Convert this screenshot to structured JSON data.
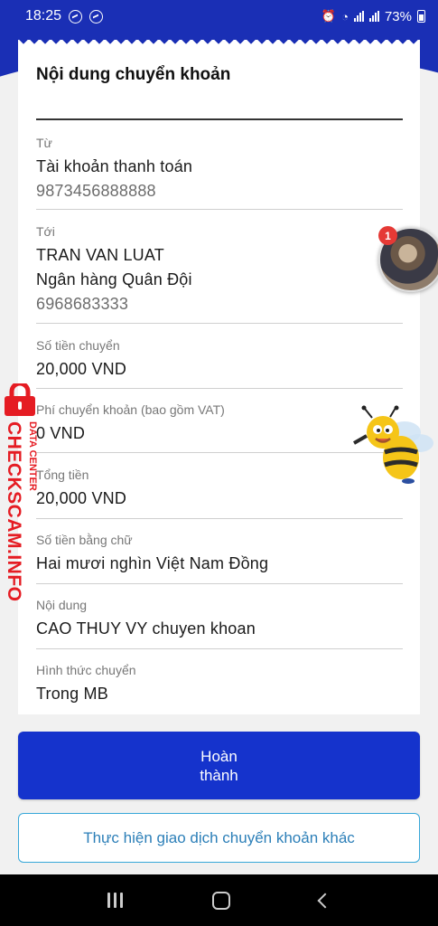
{
  "status_bar": {
    "time": "18:25",
    "battery": "73%"
  },
  "card": {
    "title": "Nội dung chuyển khoản"
  },
  "fields": {
    "from": {
      "label": "Từ",
      "account_type": "Tài khoản thanh toán",
      "account_number": "9873456888888"
    },
    "to": {
      "label": "Tới",
      "name": "TRAN VAN LUAT",
      "bank": "Ngân hàng Quân Đội",
      "account_number": "6968683333"
    },
    "amount": {
      "label": "Số tiền chuyển",
      "value": "20,000 VND"
    },
    "fee": {
      "label": "Phí chuyển khoản (bao gồm VAT)",
      "value": "0 VND"
    },
    "total": {
      "label": "Tổng tiền",
      "value": "20,000 VND"
    },
    "amount_words": {
      "label": "Số tiền bằng chữ",
      "value": "Hai mươi nghìn Việt Nam Đồng"
    },
    "content": {
      "label": "Nội dung",
      "value": "CAO THUY VY chuyen khoan"
    },
    "method": {
      "label": "Hình thức chuyển",
      "value": "Trong MB"
    }
  },
  "buttons": {
    "done_line1": "Hoàn",
    "done_line2": "thành",
    "other_transfer": "Thực hiện giao dịch chuyển khoản khác"
  },
  "chat_head": {
    "badge_count": "1"
  },
  "watermark": {
    "site": "CHECKSCAM.INFO",
    "sub": "DATA CENTER"
  },
  "colors": {
    "primary": "#1533cc",
    "header": "#1a2fb5",
    "outline": "#37a7d8",
    "watermark": "#e51c23"
  }
}
